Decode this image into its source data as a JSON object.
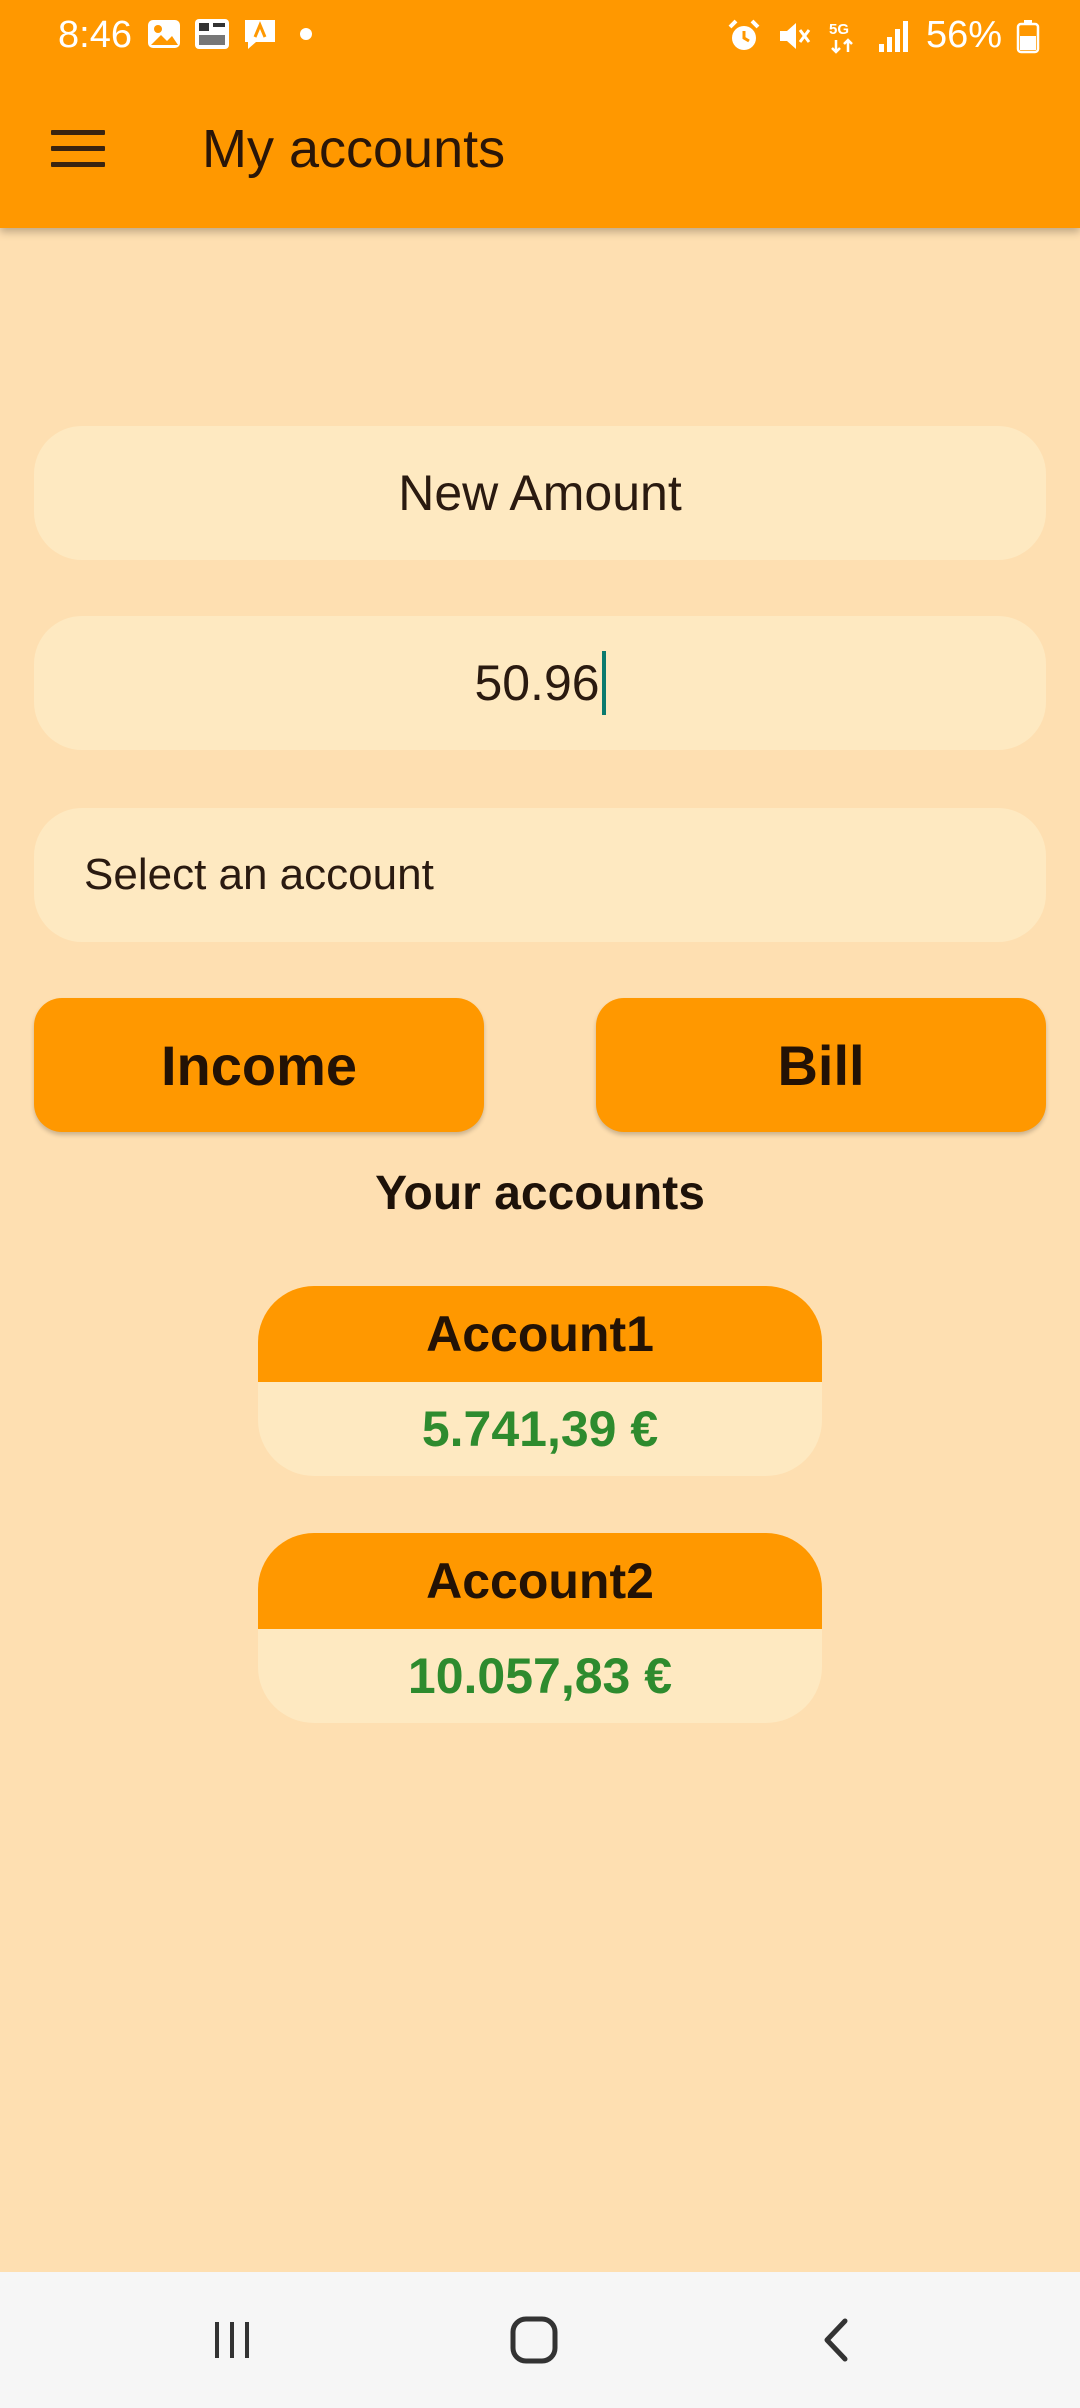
{
  "status_bar": {
    "time": "8:46",
    "battery": "56%",
    "left_icons": [
      "gallery-icon",
      "app-icon",
      "messages-icon",
      "notification-dot"
    ],
    "right_icons": [
      "alarm-icon",
      "mute-icon",
      "5g-icon",
      "signal-icon",
      "battery-icon"
    ]
  },
  "app_bar": {
    "title": "My accounts",
    "menu_icon": "hamburger-menu-icon"
  },
  "form": {
    "description_placeholder": "New Amount",
    "amount_value": "50.96",
    "account_select_label": "Select an account"
  },
  "actions": {
    "income_label": "Income",
    "bill_label": "Bill"
  },
  "accounts": {
    "heading": "Your accounts",
    "items": [
      {
        "name": "Account1",
        "balance": "5.741,39 €"
      },
      {
        "name": "Account2",
        "balance": "10.057,83 €"
      }
    ]
  },
  "colors": {
    "app_bar": "#FF9800",
    "background": "#FEDFB1",
    "field": "#FEE9C1",
    "positive_balance": "#2E8B2E"
  },
  "nav_bar": {
    "icons": [
      "recent-apps-icon",
      "home-icon",
      "back-icon"
    ]
  }
}
